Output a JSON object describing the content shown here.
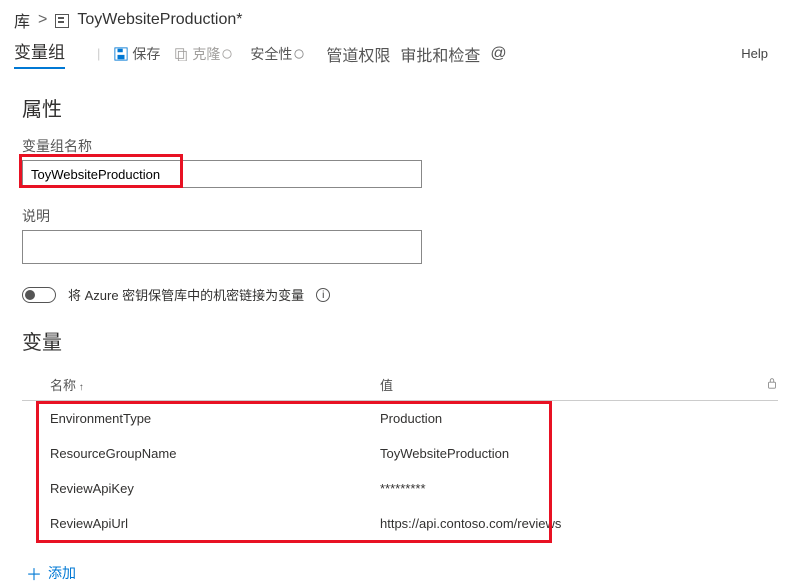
{
  "breadcrumb": {
    "root": "库",
    "sep": ">",
    "title": "ToyWebsiteProduction*"
  },
  "tabs": {
    "active": "变量组"
  },
  "toolbar": {
    "save": "保存",
    "clone": "克隆",
    "security": "安全性",
    "pipeline_perm": "管道权限",
    "approvals": "审批和检查",
    "at": "@",
    "help": "Help"
  },
  "properties": {
    "heading": "属性",
    "name_label": "变量组名称",
    "name_value": "ToyWebsiteProduction",
    "desc_label": "说明",
    "desc_value": "",
    "kv_toggle_label": "将 Azure 密钥保管库中的机密链接为变量"
  },
  "variables": {
    "heading": "变量",
    "col_name": "名称",
    "col_value": "值",
    "rows": [
      {
        "name": "EnvironmentType",
        "value": "Production"
      },
      {
        "name": "ResourceGroupName",
        "value": "ToyWebsiteProduction"
      },
      {
        "name": "ReviewApiKey",
        "value": "*********"
      },
      {
        "name": "ReviewApiUrl",
        "value": "https://api.contoso.com/reviews"
      }
    ],
    "add_label": "添加"
  }
}
